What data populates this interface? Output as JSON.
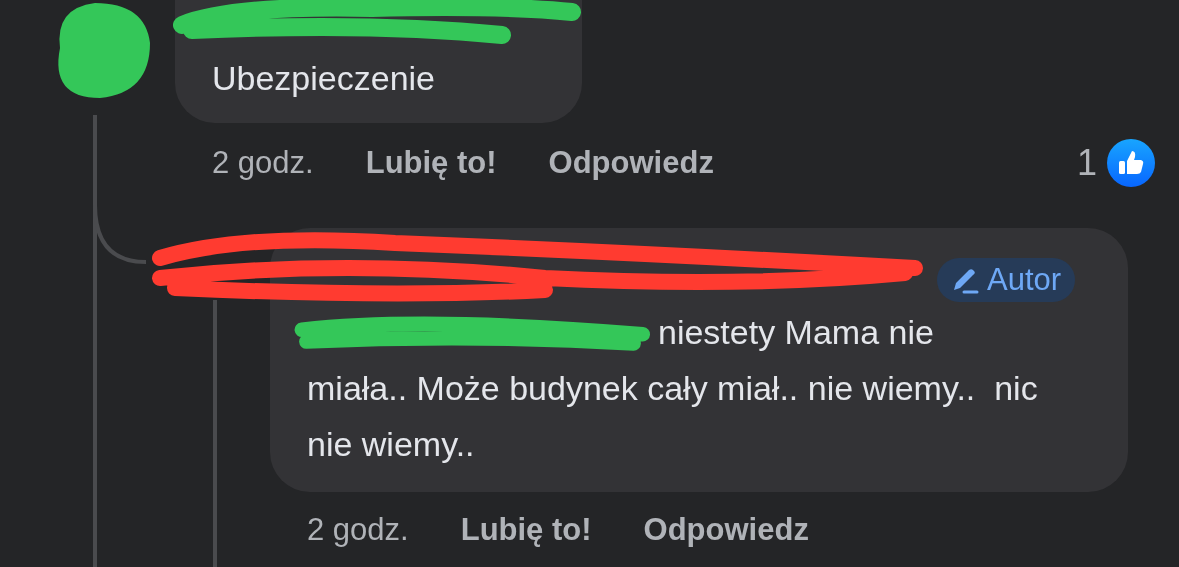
{
  "comment": {
    "text": "Ubezpieczenie",
    "time": "2 godz.",
    "actions": [
      "Lubię to!",
      "Odpowiedz"
    ],
    "reactions": {
      "count": "1"
    }
  },
  "reply": {
    "badge": "Autor",
    "text_after_mention": "niestety Mama nie",
    "text_continued": "miała.. Może budynek cały miał.. nie wiemy..  nic nie wiemy..",
    "time": "2 godz.",
    "actions": [
      "Lubię to!",
      "Odpowiedz"
    ]
  }
}
